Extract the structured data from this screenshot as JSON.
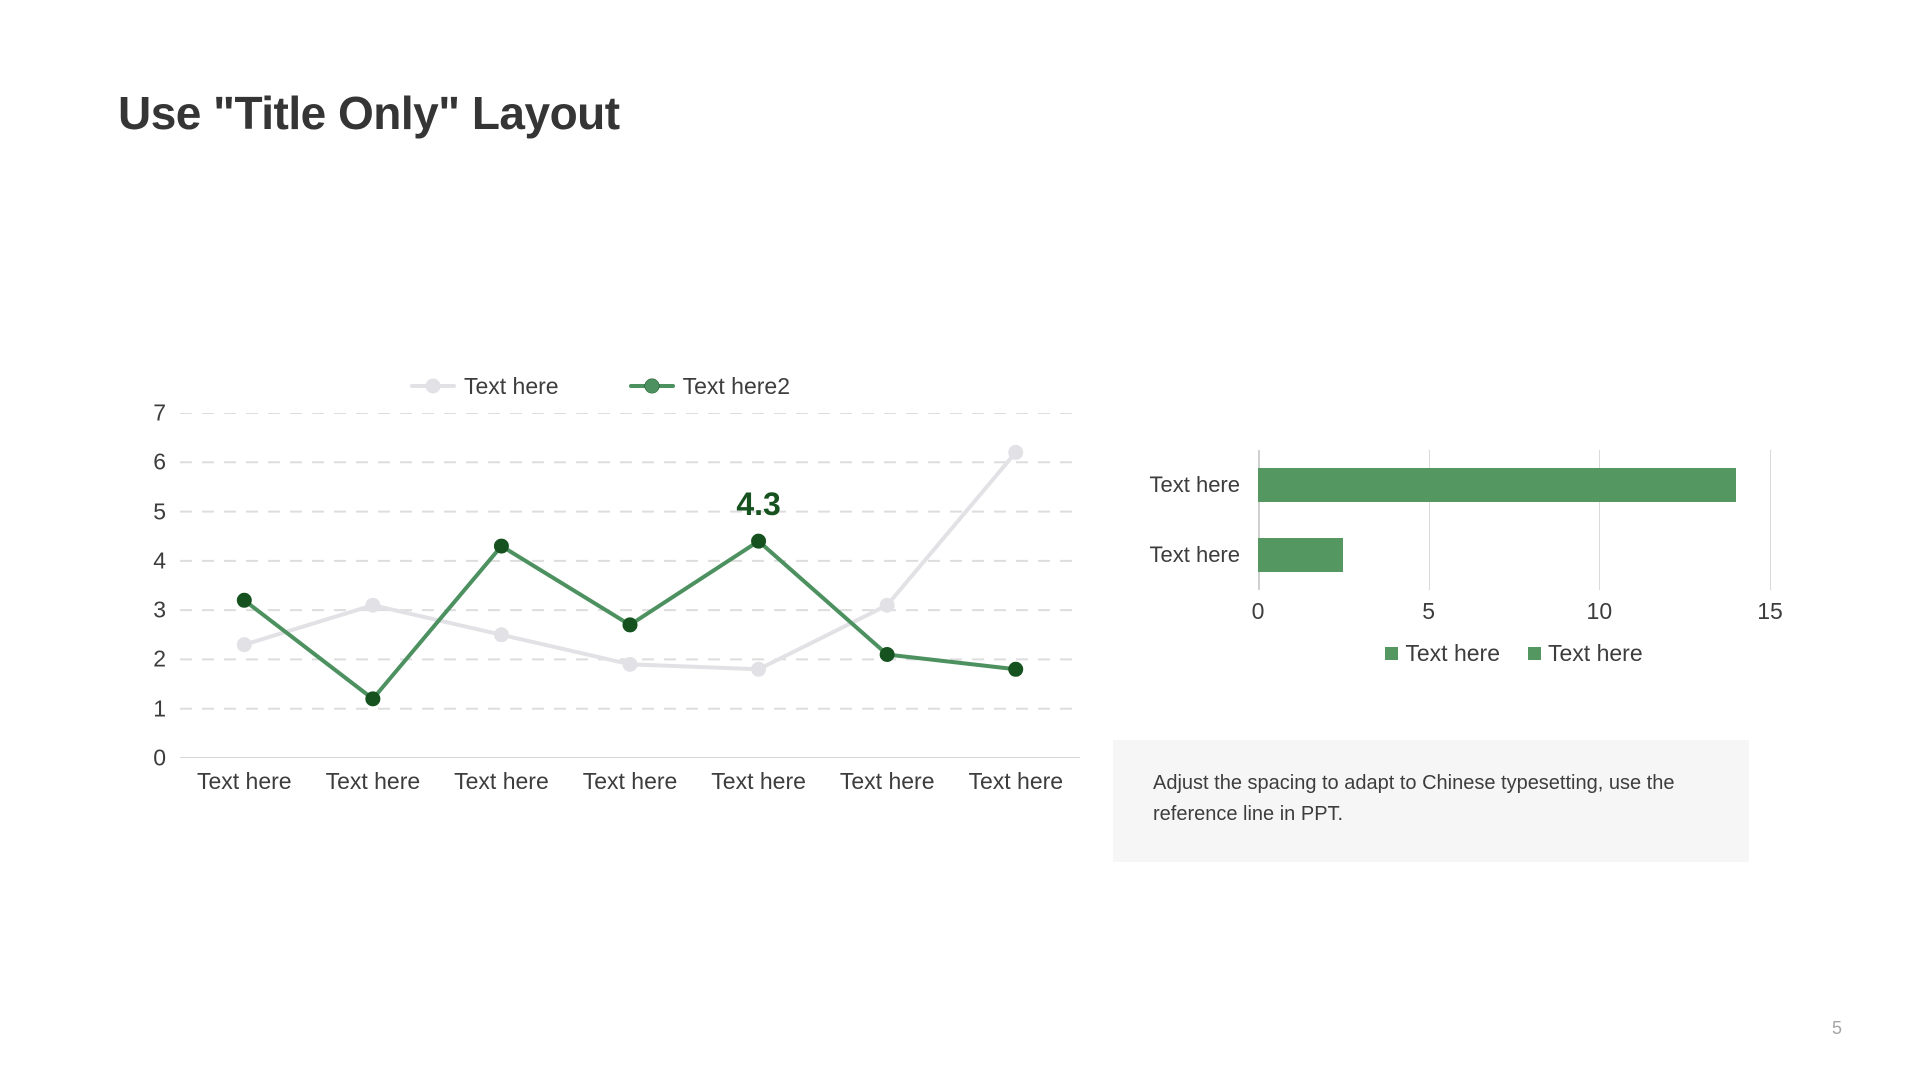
{
  "slide": {
    "title": "Use \"Title Only\" Layout",
    "page_number": "5",
    "background_color": "#ffffff"
  },
  "colors": {
    "title_text": "#353535",
    "body_text": "#3d3d3d",
    "series_gray": "#e2e2e6",
    "series_green_line": "#4d9160",
    "series_green_marker": "#15521f",
    "bar_green": "#549760",
    "gridline": "#dddddd",
    "note_bg": "#f6f6f6",
    "page_number": "#a6a6a6"
  },
  "note": {
    "text": "Adjust the spacing to adapt to Chinese typesetting, use the reference line in PPT."
  },
  "chart_data": [
    {
      "id": "line-chart",
      "type": "line",
      "title": "",
      "xlabel": "",
      "ylabel": "",
      "ylim": [
        0,
        7
      ],
      "yticks": [
        0,
        1,
        2,
        3,
        4,
        5,
        6,
        7
      ],
      "grid": true,
      "legend_position": "top",
      "categories": [
        "Text here",
        "Text here",
        "Text here",
        "Text here",
        "Text here",
        "Text here",
        "Text here"
      ],
      "series": [
        {
          "name": "Text here",
          "color": "#e2e2e6",
          "marker_color": "#e2e2e6",
          "values": [
            2.3,
            3.1,
            2.5,
            1.9,
            1.8,
            3.1,
            6.2
          ]
        },
        {
          "name": "Text here2",
          "color": "#4d9160",
          "marker_color": "#15521f",
          "values": [
            3.2,
            1.2,
            4.3,
            2.7,
            4.4,
            2.1,
            1.8
          ]
        }
      ],
      "annotations": [
        {
          "text": "4.3",
          "series": "Text here2",
          "point_index": 4,
          "color": "#15521f"
        }
      ]
    },
    {
      "id": "bar-chart",
      "type": "bar",
      "orientation": "horizontal",
      "title": "",
      "xlabel": "",
      "ylabel": "",
      "xlim": [
        0,
        15
      ],
      "xticks": [
        0,
        5,
        10,
        15
      ],
      "grid": true,
      "legend_position": "bottom",
      "categories": [
        "Text here",
        "Text here"
      ],
      "values": [
        14.0,
        2.5
      ],
      "legend_entries": [
        "Text here",
        "Text here"
      ],
      "bar_color": "#549760"
    }
  ]
}
